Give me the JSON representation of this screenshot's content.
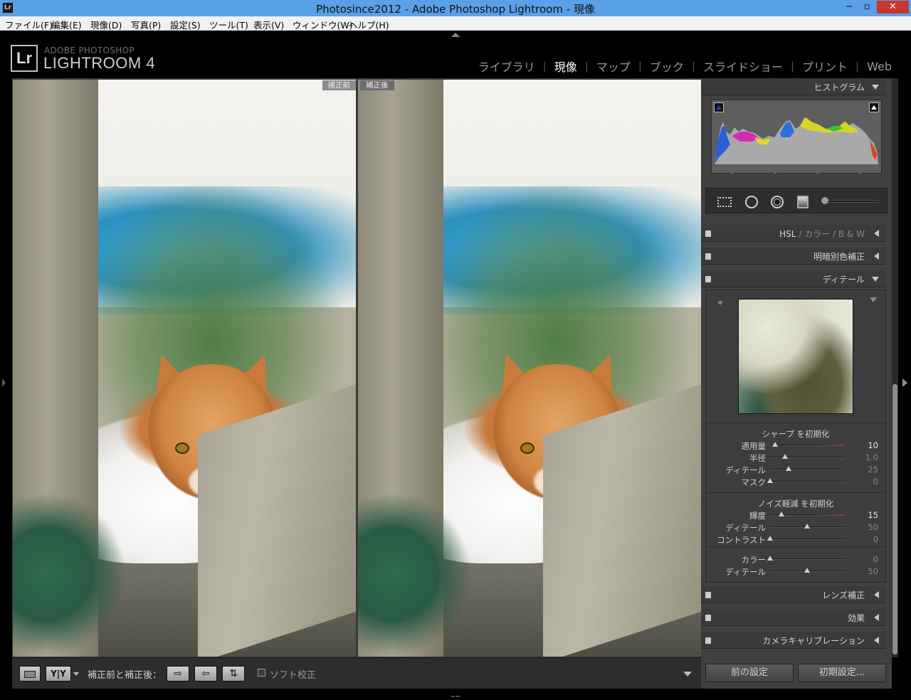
{
  "window": {
    "app_icon": "Lr",
    "title": "Photosince2012 - Adobe Photoshop Lightroom - 現像",
    "controls": {
      "minimize": "−",
      "maximize": "▫",
      "close": "✕"
    }
  },
  "menu": {
    "items": [
      "ファイル(F)",
      "編集(E)",
      "現像(D)",
      "写真(P)",
      "設定(S)",
      "ツール(T)",
      "表示(V)",
      "ウィンドウ(W)",
      "ヘルプ(H)"
    ]
  },
  "brand": {
    "logo": "Lr",
    "line1": "ADOBE PHOTOSHOP",
    "line2": "LIGHTROOM 4"
  },
  "modules": {
    "items": [
      "ライブラリ",
      "現像",
      "マップ",
      "ブック",
      "スライドショー",
      "プリント",
      "Web"
    ],
    "active": "現像",
    "separator": "|"
  },
  "view": {
    "before_label": "補正前",
    "after_label": "補正後"
  },
  "toolbar": {
    "view_mode_icon": "loupe-rectangle-icon",
    "yy_label": "Y|Y",
    "compare_label": "補正前と補正後：",
    "copy_before_to_after": "⇨",
    "copy_after_to_before": "⇦",
    "swap": "⇅",
    "softproof_label": "ソフト校正"
  },
  "right_panel": {
    "histogram": {
      "title": "ヒストグラム",
      "ticks": [
        "–",
        "–",
        "–",
        "–"
      ]
    },
    "tool_strip": {
      "icons": [
        "crop-overlay-icon",
        "spot-removal-icon",
        "redeye-icon",
        "graduated-filter-icon",
        "adjustment-brush-slider-icon"
      ]
    },
    "sections": {
      "hsl": {
        "part1": "HSL",
        "sep1": "/",
        "part2": "カラー",
        "sep2": "/",
        "part3": "B & W"
      },
      "split_toning": "明暗別色補正",
      "detail": "ディテール",
      "lens": "レンズ補正",
      "effects": "効果",
      "calibration": "カメラキャリブレーション"
    },
    "sharpening": {
      "title": "シャープ を初期化",
      "rows": [
        {
          "label": "適用量",
          "value": "10",
          "fraction": 0.07
        },
        {
          "label": "半径",
          "value": "1.0",
          "fraction": 0.2
        },
        {
          "label": "ディテール",
          "value": "25",
          "fraction": 0.25
        },
        {
          "label": "マスク",
          "value": "0",
          "fraction": 0.0
        }
      ]
    },
    "noise": {
      "title": "ノイズ軽減 を初期化",
      "rows": [
        {
          "label": "輝度",
          "value": "15",
          "fraction": 0.15
        },
        {
          "label": "ディテール",
          "value": "50",
          "fraction": 0.5
        },
        {
          "label": "コントラスト",
          "value": "0",
          "fraction": 0.0
        }
      ],
      "color_rows": [
        {
          "label": "カラー",
          "value": "0",
          "fraction": 0.0
        },
        {
          "label": "ディテール",
          "value": "50",
          "fraction": 0.5
        }
      ]
    },
    "buttons": {
      "previous": "前の設定",
      "reset": "初期設定..."
    }
  },
  "colors": {
    "titlebar": "#5aa0e6",
    "close": "#c7372f",
    "panel": "#404040",
    "background": "#000000",
    "accent_red": "#aa3333"
  }
}
